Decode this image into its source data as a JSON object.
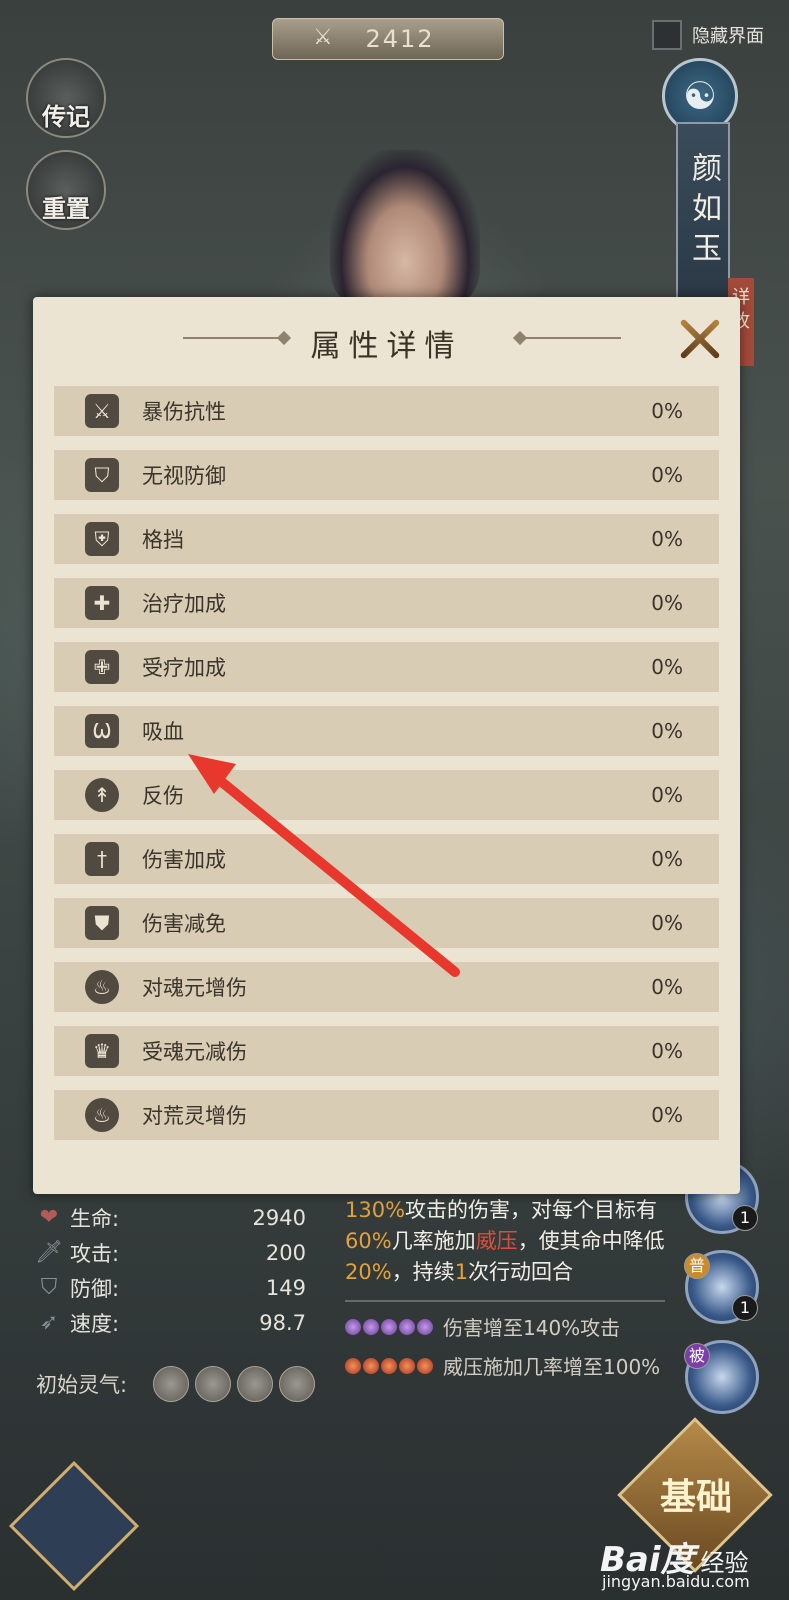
{
  "top_bar": {
    "score": "2412",
    "hide_ui_label": "隐藏界面"
  },
  "side_buttons": {
    "biography": "传记",
    "reset": "重置"
  },
  "character": {
    "name": "颜如玉",
    "side_tab_partial": "详\n故"
  },
  "dialog": {
    "title": "属性详情",
    "rows": [
      {
        "label": "暴伤抗性",
        "value": "0%",
        "icon": "sword-shield-icon"
      },
      {
        "label": "无视防御",
        "value": "0%",
        "icon": "pierce-shield-icon"
      },
      {
        "label": "格挡",
        "value": "0%",
        "icon": "block-shield-icon"
      },
      {
        "label": "治疗加成",
        "value": "0%",
        "icon": "heal-hand-icon"
      },
      {
        "label": "受疗加成",
        "value": "0%",
        "icon": "body-heal-icon"
      },
      {
        "label": "吸血",
        "value": "0%",
        "icon": "fang-icon"
      },
      {
        "label": "反伤",
        "value": "0%",
        "icon": "reflect-icon"
      },
      {
        "label": "伤害加成",
        "value": "0%",
        "icon": "sword-plus-icon"
      },
      {
        "label": "伤害减免",
        "value": "0%",
        "icon": "shield-plus-icon"
      },
      {
        "label": "对魂元增伤",
        "value": "0%",
        "icon": "soul-flame-icon"
      },
      {
        "label": "受魂元减伤",
        "value": "0%",
        "icon": "soul-crown-icon"
      },
      {
        "label": "对荒灵增伤",
        "value": "0%",
        "icon": "wild-flame-icon"
      }
    ]
  },
  "stats": [
    {
      "label": "生命:",
      "value": "2940",
      "icon": "heart-icon",
      "color": "#b35a5a"
    },
    {
      "label": "攻击:",
      "value": "200",
      "icon": "sword-icon",
      "color": "#8a8f98"
    },
    {
      "label": "防御:",
      "value": "149",
      "icon": "shield-icon",
      "color": "#8a8f98"
    },
    {
      "label": "速度:",
      "value": "98.7",
      "icon": "wing-icon",
      "color": "#8a8f98"
    }
  ],
  "initial_qi_label": "初始灵气:",
  "skill": {
    "p1": "130%",
    "p2": "攻击的伤害，对每个目标有",
    "p3": "60%",
    "p4": "几率施加",
    "p5": "威压",
    "p6": "，使其命中降低",
    "p7": "20%",
    "p8": "，持续",
    "p9": "1",
    "p10": "次行动回合",
    "upgrade1": "伤害增至140%攻击",
    "upgrade2": "威压施加几率增至100%"
  },
  "right_skills": {
    "badge1": "1",
    "badge2": "1",
    "tag_pu": "普",
    "tag_bei": "被"
  },
  "bottom_corner_label": "基础",
  "watermark": {
    "brand": "Bai度",
    "jingyan": "经验",
    "url": "jingyan.baidu.com"
  }
}
